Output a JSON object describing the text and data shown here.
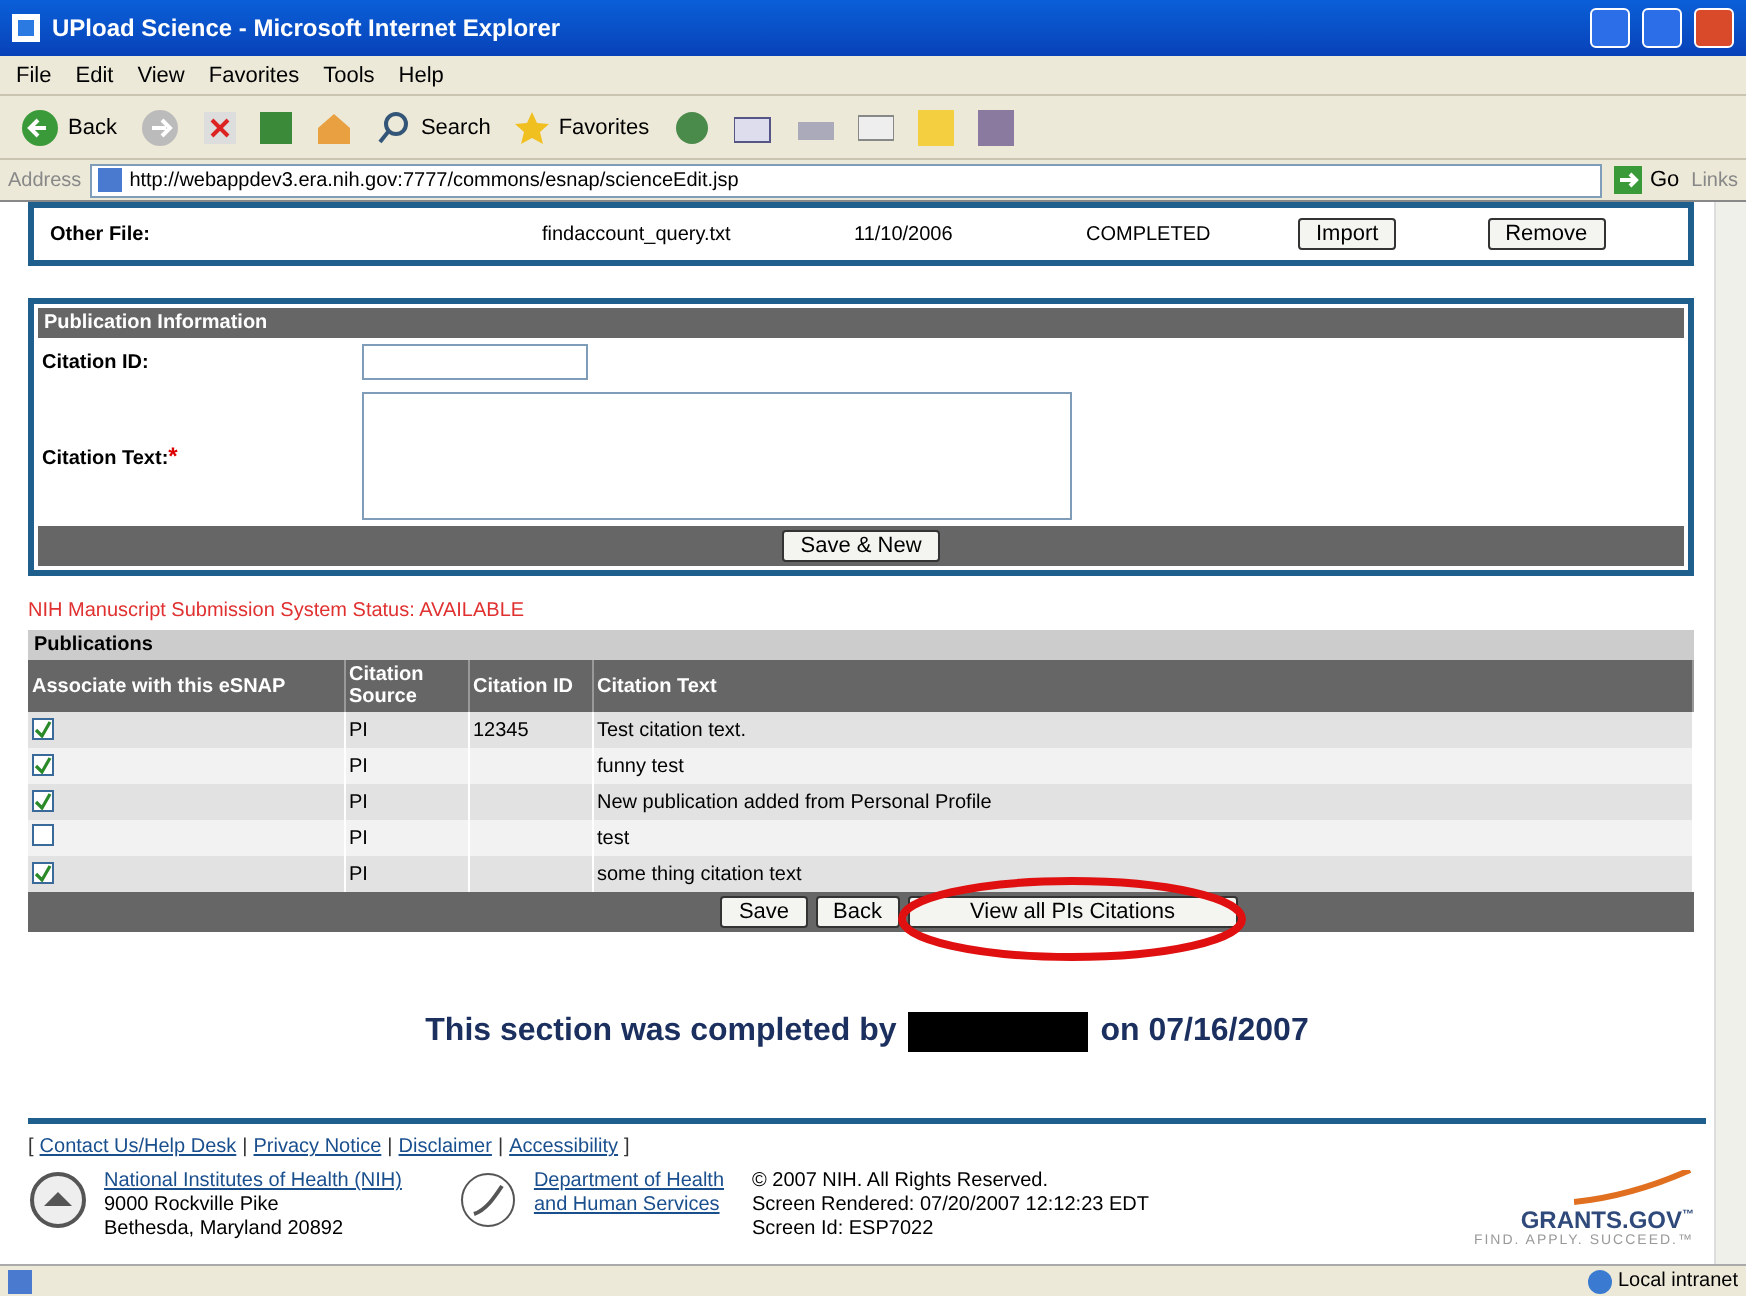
{
  "window": {
    "title": "UPload Science - Microsoft Internet Explorer"
  },
  "menu": [
    "File",
    "Edit",
    "View",
    "Favorites",
    "Tools",
    "Help"
  ],
  "toolbar": {
    "back": "Back",
    "search": "Search",
    "favorites": "Favorites"
  },
  "address": {
    "label": "Address",
    "url": "http://webappdev3.era.nih.gov:7777/commons/esnap/scienceEdit.jsp",
    "go": "Go",
    "links": "Links"
  },
  "file_row": {
    "label": "Other File:",
    "file": "findaccount_query.txt",
    "date": "11/10/2006",
    "status": "COMPLETED",
    "buttons": [
      "Import",
      "Remove"
    ]
  },
  "publication_info": {
    "title": "Publication Information",
    "citation_id_label": "Citation ID:",
    "citation_text_label": "Citation Text:",
    "required_mark": "*",
    "save_button": "Save & New"
  },
  "system_status": "NIH Manuscript Submission System Status: AVAILABLE",
  "publications": {
    "title": "Publications",
    "columns": [
      "Associate with this eSNAP",
      "Citation Source",
      "Citation ID",
      "Citation Text"
    ],
    "rows": [
      {
        "checked": true,
        "source": "PI",
        "id": "12345",
        "text": "Test citation text."
      },
      {
        "checked": true,
        "source": "PI",
        "id": "",
        "text": "funny test"
      },
      {
        "checked": true,
        "source": "PI",
        "id": "",
        "text": "New publication added from Personal Profile"
      },
      {
        "checked": false,
        "source": "PI",
        "id": "",
        "text": "test"
      },
      {
        "checked": true,
        "source": "PI",
        "id": "",
        "text": "some thing citation text"
      }
    ],
    "buttons": [
      "Save",
      "Back",
      "View all PIs Citations"
    ]
  },
  "completed": {
    "before": "This section was completed by",
    "after": "on 07/16/2007"
  },
  "footer": {
    "bracket_open": "[",
    "separators": [
      "|",
      "|",
      "|"
    ],
    "bracket_close": "]",
    "links": [
      "Contact Us/Help Desk",
      "Privacy Notice",
      "Disclaimer",
      "Accessibility"
    ],
    "nih_link": "National Institutes of Health (NIH)",
    "nih_address": [
      "9000 Rockville Pike",
      "Bethesda, Maryland 20892"
    ],
    "hhs_link": [
      "Department of Health",
      "and Human Services"
    ],
    "info": [
      "© 2007 NIH. All Rights Reserved.",
      "Screen Rendered: 07/20/2007 12:12:23 EDT",
      "Screen Id: ESP7022"
    ],
    "brand": "GRANTS.GOV",
    "brand_mark": "™",
    "tagline": "FIND. APPLY. SUCCEED.",
    "tagline_mark": "™"
  },
  "status_bar": {
    "zone": "Local intranet"
  }
}
